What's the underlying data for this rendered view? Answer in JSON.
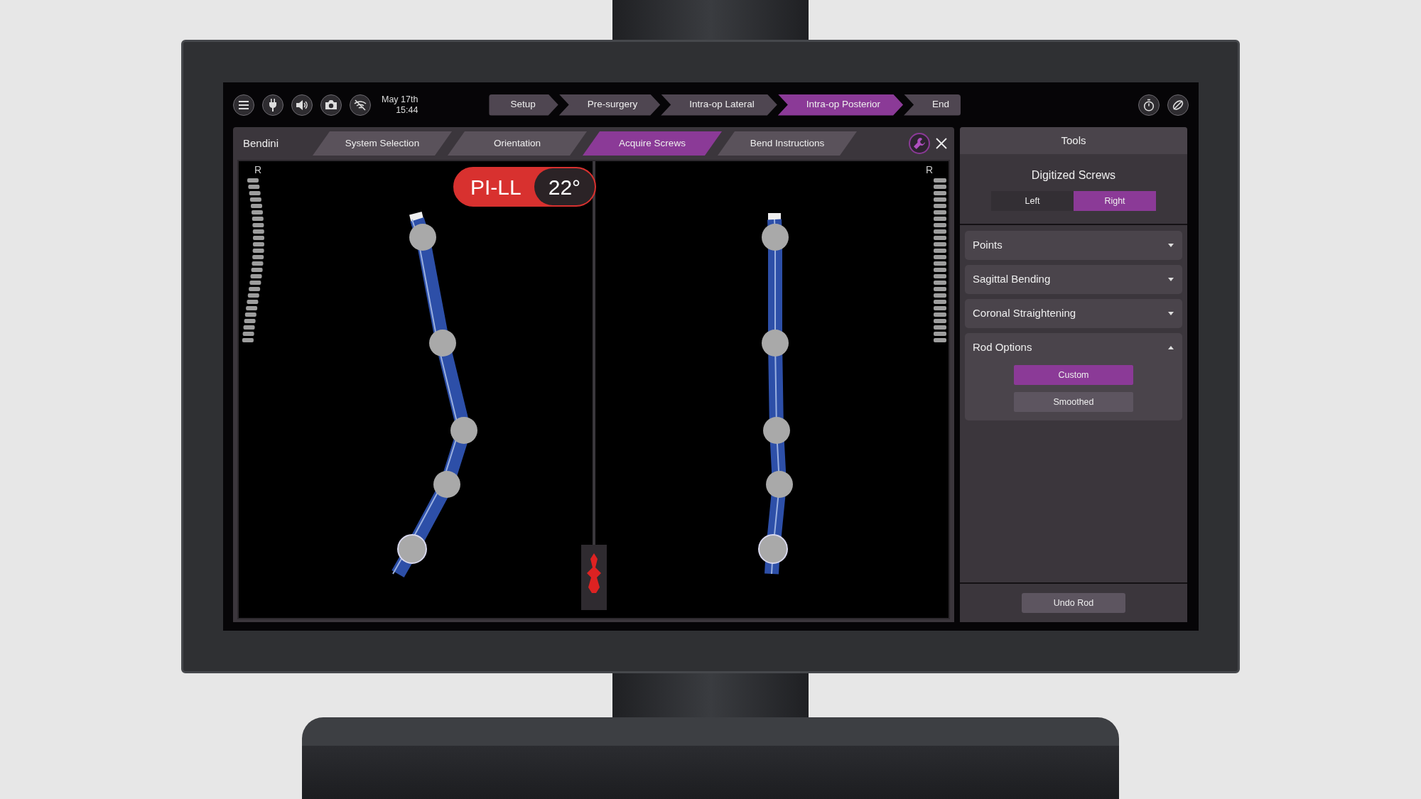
{
  "top_bar": {
    "date": "May 17th",
    "time": "15:44",
    "steps": [
      {
        "label": "Setup",
        "selected": false
      },
      {
        "label": "Pre-surgery",
        "selected": false
      },
      {
        "label": "Intra-op Lateral",
        "selected": false
      },
      {
        "label": "Intra-op Posterior",
        "selected": true
      },
      {
        "label": "End",
        "selected": false
      }
    ]
  },
  "module": {
    "title": "Bendini",
    "tabs": [
      {
        "label": "System Selection",
        "selected": false
      },
      {
        "label": "Orientation",
        "selected": false
      },
      {
        "label": "Acquire Screws",
        "selected": true
      },
      {
        "label": "Bend Instructions",
        "selected": false
      }
    ]
  },
  "viewer": {
    "left_marker": "R",
    "right_marker": "R",
    "badge": {
      "label": "PI-LL",
      "value": "22°"
    }
  },
  "tools": {
    "title": "Tools",
    "section": "Digitized Screws",
    "sides": [
      {
        "label": "Left",
        "selected": false
      },
      {
        "label": "Right",
        "selected": true
      }
    ],
    "accordions": [
      {
        "label": "Points",
        "expanded": false
      },
      {
        "label": "Sagittal Bending",
        "expanded": false
      },
      {
        "label": "Coronal Straightening",
        "expanded": false
      },
      {
        "label": "Rod Options",
        "expanded": true,
        "options": [
          {
            "label": "Custom",
            "selected": true
          },
          {
            "label": "Smoothed",
            "selected": false
          }
        ]
      }
    ],
    "undo": "Undo Rod"
  }
}
